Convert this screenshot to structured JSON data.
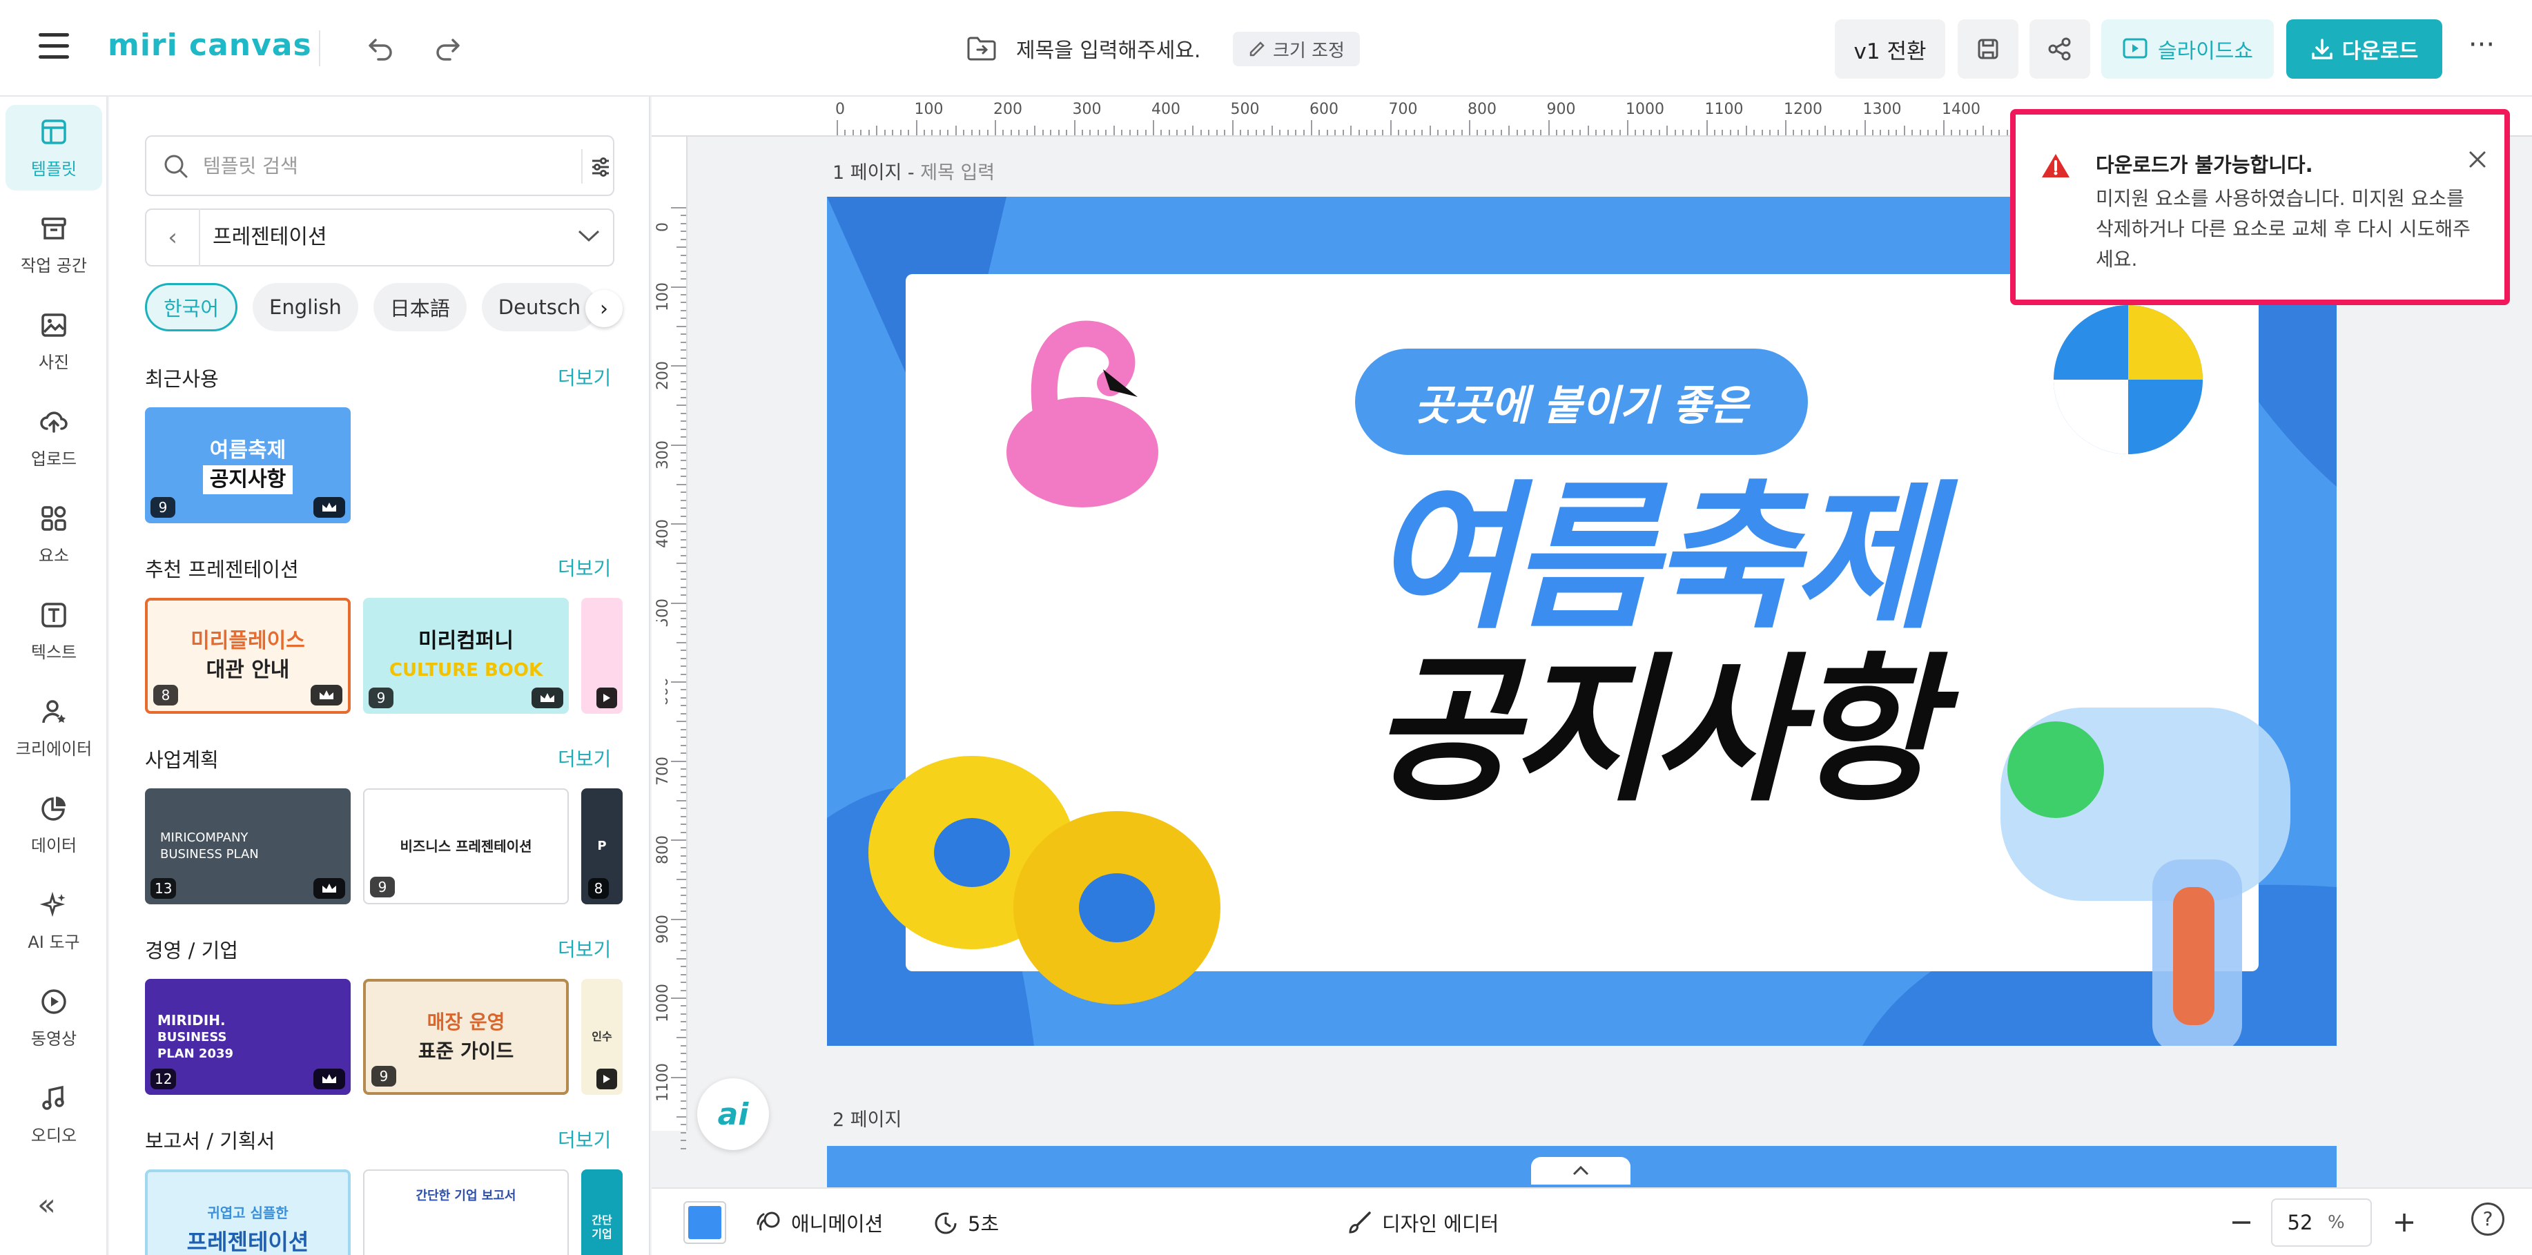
{
  "header": {
    "logo": "miri canvas",
    "doc_title": "제목을 입력해주세요.",
    "resize_label": "크기 조정",
    "v1_label": "v1 전환",
    "slideshow_label": "슬라이드쇼",
    "download_label": "다운로드",
    "more_label": "···"
  },
  "rail": {
    "items": [
      {
        "label": "템플릿",
        "icon": "template-icon"
      },
      {
        "label": "작업 공간",
        "icon": "archive-icon"
      },
      {
        "label": "사진",
        "icon": "image-icon"
      },
      {
        "label": "업로드",
        "icon": "cloud-upload-icon"
      },
      {
        "label": "요소",
        "icon": "shapes-icon"
      },
      {
        "label": "텍스트",
        "icon": "text-icon"
      },
      {
        "label": "크리에이터",
        "icon": "creator-icon"
      },
      {
        "label": "데이터",
        "icon": "chart-icon"
      },
      {
        "label": "AI 도구",
        "icon": "sparkle-icon"
      },
      {
        "label": "동영상",
        "icon": "play-icon"
      },
      {
        "label": "오디오",
        "icon": "music-icon"
      }
    ],
    "collapse": "«"
  },
  "panel": {
    "search_placeholder": "템플릿 검색",
    "category": "프레젠테이션",
    "languages": [
      "한국어",
      "English",
      "日本語",
      "Deutsch"
    ],
    "more_label": "더보기",
    "sections": [
      {
        "title": "최근사용",
        "thumbs": [
          {
            "l1": "여름축제",
            "l2": "공지사항",
            "count": "9"
          }
        ]
      },
      {
        "title": "추천 프레젠테이션",
        "thumbs": [
          {
            "l1": "미리플레이스",
            "l2": "대관 안내",
            "count": "8"
          },
          {
            "l1": "미리컴퍼니",
            "l2": "CULTURE BOOK",
            "count": "9"
          }
        ]
      },
      {
        "title": "사업계획",
        "thumbs": [
          {
            "l1": "MIRICOMPANY",
            "l2": "BUSINESS PLAN",
            "count": "13"
          },
          {
            "l1": "비즈니스 프레젠테이션",
            "l2": "",
            "count": "9"
          },
          {
            "l1": "P",
            "l2": "",
            "count": "8"
          }
        ]
      },
      {
        "title": "경영 / 기업",
        "thumbs": [
          {
            "l1": "MIRIDIH.",
            "l2": "BUSINESS PLAN 2039",
            "count": "12"
          },
          {
            "l1": "매장 운영",
            "l2": "표준 가이드",
            "count": "9"
          },
          {
            "l1": "인수",
            "l2": "",
            "count": ""
          }
        ]
      },
      {
        "title": "보고서 / 기획서",
        "thumbs": [
          {
            "l1": "귀엽고 심플한",
            "l2": "프레젠테이션",
            "count": ""
          },
          {
            "l1": "간단한 기업 보고서",
            "l2": "",
            "count": ""
          },
          {
            "l1": "간단",
            "l2": "기업",
            "count": ""
          }
        ]
      }
    ]
  },
  "ruler": {
    "top": [
      "0",
      "100",
      "200",
      "300",
      "400",
      "500",
      "600",
      "700",
      "800",
      "900",
      "1000",
      "1100",
      "1200",
      "1300",
      "1400"
    ],
    "left": [
      "0",
      "100",
      "200",
      "300",
      "400",
      "500",
      "600",
      "700",
      "800",
      "900",
      "1000",
      "1100"
    ]
  },
  "canvas": {
    "page1_label": "1 페이지 - ",
    "page1_sub": "제목 입력",
    "page2_label": "2 페이지",
    "slide_pill": "곳곳에 붙이기 좋은",
    "slide_h1": "여름축제",
    "slide_h2": "공지사항",
    "ai_label": "ai"
  },
  "bottombar": {
    "animation_label": "애니메이션",
    "duration_label": "5초",
    "design_editor_label": "디자인 에디터",
    "zoom_value": "52",
    "zoom_unit": "%",
    "help": "?"
  },
  "toast": {
    "title": "다운로드가 불가능합니다.",
    "message": "미지원 요소를 사용하였습니다. 미지원 요소를 삭제하거나 다른 요소로 교체 후 다시 시도해주세요."
  },
  "colors": {
    "accent": "#1ab0bd",
    "alert_border": "#f0185a",
    "slide_blue": "#4a9af0"
  }
}
